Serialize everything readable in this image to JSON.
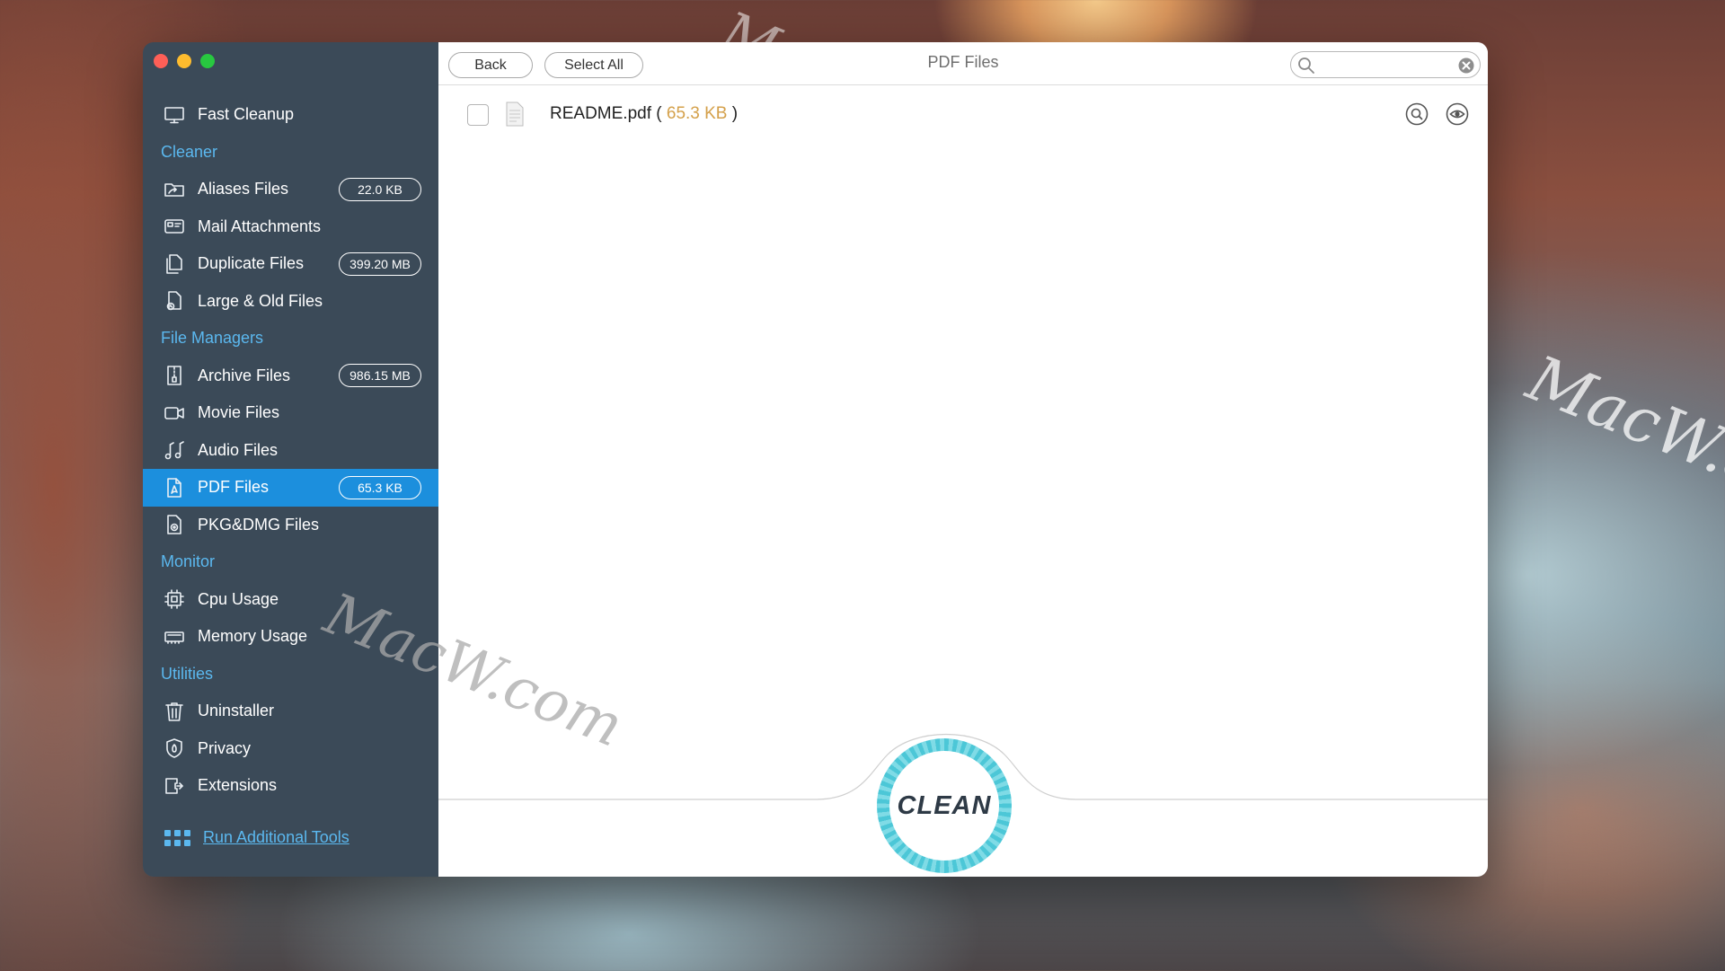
{
  "window": {
    "title": "PDF Files"
  },
  "sidebar": {
    "items": [
      {
        "type": "item",
        "name": "fast-cleanup",
        "icon": "monitor-icon",
        "label": "Fast Cleanup",
        "badge": ""
      },
      {
        "type": "section",
        "label": "Cleaner"
      },
      {
        "type": "item",
        "name": "aliases-files",
        "icon": "folder-alias-icon",
        "label": "Aliases Files",
        "badge": "22.0 KB"
      },
      {
        "type": "item",
        "name": "mail-attachments",
        "icon": "mail-attachment-icon",
        "label": "Mail Attachments",
        "badge": ""
      },
      {
        "type": "item",
        "name": "duplicate-files",
        "icon": "duplicate-icon",
        "label": "Duplicate Files",
        "badge": "399.20 MB"
      },
      {
        "type": "item",
        "name": "large-old-files",
        "icon": "large-file-icon",
        "label": "Large & Old Files",
        "badge": ""
      },
      {
        "type": "section",
        "label": "File Managers"
      },
      {
        "type": "item",
        "name": "archive-files",
        "icon": "archive-icon",
        "label": "Archive Files",
        "badge": "986.15 MB"
      },
      {
        "type": "item",
        "name": "movie-files",
        "icon": "video-camera-icon",
        "label": "Movie Files",
        "badge": ""
      },
      {
        "type": "item",
        "name": "audio-files",
        "icon": "music-note-icon",
        "label": "Audio Files",
        "badge": ""
      },
      {
        "type": "item",
        "name": "pdf-files",
        "icon": "pdf-icon",
        "label": "PDF Files",
        "badge": "65.3 KB",
        "active": true
      },
      {
        "type": "item",
        "name": "pkg-dmg-files",
        "icon": "package-icon",
        "label": "PKG&DMG Files",
        "badge": ""
      },
      {
        "type": "section",
        "label": "Monitor"
      },
      {
        "type": "item",
        "name": "cpu-usage",
        "icon": "cpu-icon",
        "label": "Cpu Usage",
        "badge": ""
      },
      {
        "type": "item",
        "name": "memory-usage",
        "icon": "memory-icon",
        "label": "Memory Usage",
        "badge": ""
      },
      {
        "type": "section",
        "label": "Utilities"
      },
      {
        "type": "item",
        "name": "uninstaller",
        "icon": "trash-icon",
        "label": "Uninstaller",
        "badge": ""
      },
      {
        "type": "item",
        "name": "privacy",
        "icon": "shield-icon",
        "label": "Privacy",
        "badge": ""
      },
      {
        "type": "item",
        "name": "extensions",
        "icon": "extension-icon",
        "label": "Extensions",
        "badge": ""
      }
    ],
    "run_tools_label": "Run Additional Tools"
  },
  "toolbar": {
    "back_label": "Back",
    "select_all_label": "Select All",
    "title": "PDF Files",
    "search_value": "",
    "search_placeholder": ""
  },
  "files": [
    {
      "name": "README.pdf",
      "size": "65.3 KB",
      "checked": false
    }
  ],
  "clean_label": "CLEAN",
  "watermark": "MacW.com",
  "colors": {
    "sidebar_bg": "#3b4a58",
    "active_bg": "#1c8fdd",
    "section_text": "#5bb8ef",
    "file_size_text": "#d4a04a",
    "clean_ring": "#4cc7d7"
  }
}
